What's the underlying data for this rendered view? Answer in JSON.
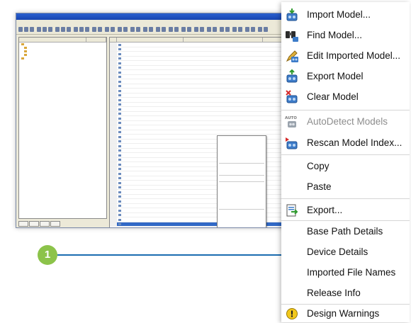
{
  "callout": {
    "number": "1"
  },
  "menu": {
    "items": [
      {
        "label": "Import Model...",
        "icon": "import-model-icon"
      },
      {
        "label": "Find Model...",
        "icon": "find-model-icon"
      },
      {
        "label": "Edit Imported Model...",
        "icon": "edit-imported-model-icon"
      },
      {
        "label": "Export Model",
        "icon": "export-model-icon"
      },
      {
        "label": "Clear Model",
        "icon": "clear-model-icon"
      },
      {
        "label": "AutoDetect Models",
        "icon": "autodetect-icon",
        "icon_text": "AUTO",
        "disabled": true
      },
      {
        "label": "Rescan Model Index...",
        "icon": "rescan-index-icon"
      },
      {
        "label": "Copy"
      },
      {
        "label": "Paste"
      },
      {
        "label": "Export...",
        "icon": "export-icon"
      },
      {
        "label": "Base Path Details"
      },
      {
        "label": "Device Details"
      },
      {
        "label": "Imported File Names"
      },
      {
        "label": "Release Info"
      },
      {
        "label": "Design Warnings",
        "icon": "warning-icon",
        "icon_text": "!"
      }
    ]
  },
  "colors": {
    "callout_green": "#8cc34a",
    "callout_line": "#1b6db0",
    "selection_blue": "#3169c6",
    "disabled_text": "#8d8d8d"
  }
}
